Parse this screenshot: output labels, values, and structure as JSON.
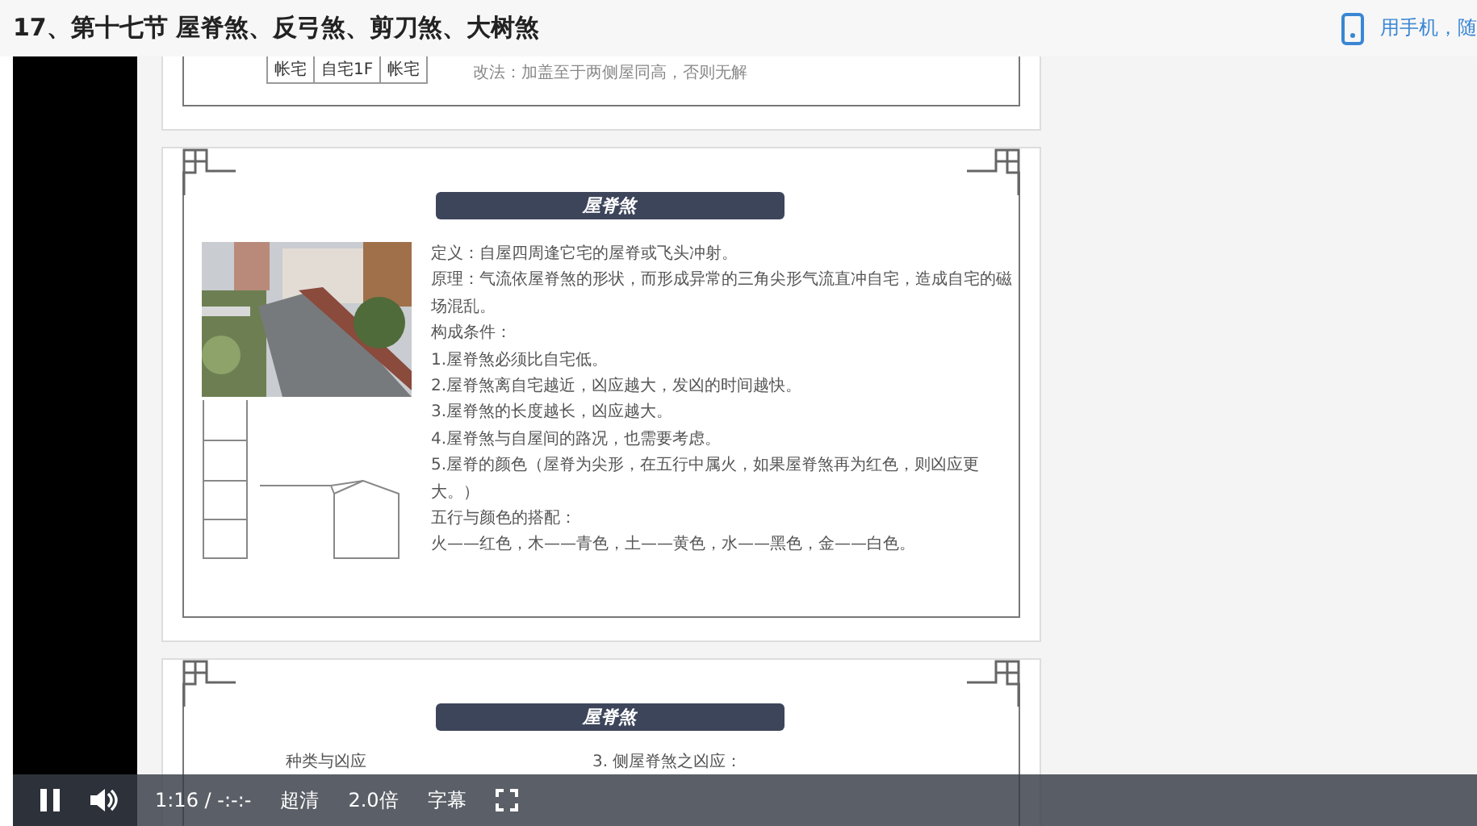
{
  "title": "17、第十七节 屋脊煞、反弓煞、剪刀煞、大树煞",
  "mobile_link": "用手机，随",
  "slides": [
    {
      "kind": "snippet",
      "table": [
        "帐宅",
        "自宅1F",
        "帐宅"
      ],
      "text": "改法：加盖至于两侧屋同高，否则无解"
    },
    {
      "kind": "main",
      "banner": "屋脊煞",
      "lines": [
        "定义：自屋四周逢它宅的屋脊或飞头冲射。",
        "原理：气流依屋脊煞的形状，而形成异常的三角尖形气流直冲自宅，造成自宅的磁场混乱。",
        "构成条件：",
        "1.屋脊煞必须比自宅低。",
        "2.屋脊煞离自宅越近，凶应越大，发凶的时间越快。",
        "3.屋脊煞的长度越长，凶应越大。",
        "4.屋脊煞与自屋间的路况，也需要考虑。",
        "5.屋脊的颜色（屋脊为尖形，在五行中属火，如果屋脊煞再为红色，则凶应更大。）",
        "五行与颜色的搭配：",
        "火——红色，木——青色，土——黄色，水——黑色，金——白色。"
      ]
    },
    {
      "kind": "columns",
      "banner": "屋脊煞",
      "left": [
        "种类与凶应"
      ],
      "right": [
        "3. 侧屋脊煞之凶应："
      ]
    }
  ],
  "controls": {
    "playing": true,
    "time": "1:16 / -:-:-",
    "quality": "超清",
    "speed": "2.0倍",
    "subtitles": "字幕"
  }
}
